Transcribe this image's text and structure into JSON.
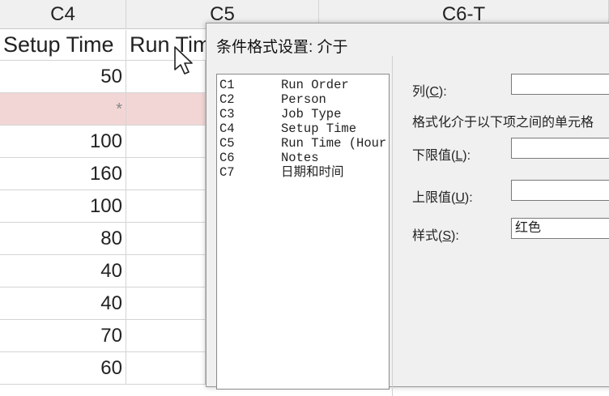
{
  "sheet": {
    "headers": [
      "C4",
      "C5",
      "C6-T"
    ],
    "names": [
      "Setup Time",
      "Run Time"
    ],
    "setup_values": [
      "50",
      "*",
      "100",
      "160",
      "100",
      "80",
      "40",
      "40",
      "70",
      "60"
    ]
  },
  "dialog": {
    "title": "条件格式设置: 介于",
    "variables": [
      {
        "id": "C1",
        "name": "Run Order"
      },
      {
        "id": "C2",
        "name": "Person"
      },
      {
        "id": "C3",
        "name": "Job Type"
      },
      {
        "id": "C4",
        "name": "Setup Time"
      },
      {
        "id": "C5",
        "name": "Run Time (Hour"
      },
      {
        "id": "C6",
        "name": "Notes"
      },
      {
        "id": "C7",
        "name": "日期和时间"
      }
    ],
    "column_label": "列(C):",
    "column_prefix": "列(",
    "column_key": "C",
    "column_suffix": "):",
    "description": "格式化介于以下项之间的单元格",
    "lower_prefix": "下限值(",
    "lower_key": "L",
    "lower_suffix": "):",
    "upper_prefix": "上限值(",
    "upper_key": "U",
    "upper_suffix": "):",
    "style_prefix": "样式(",
    "style_key": "S",
    "style_suffix": "):",
    "column_value": "",
    "lower_value": "",
    "upper_value": "",
    "style_value": "红色"
  }
}
